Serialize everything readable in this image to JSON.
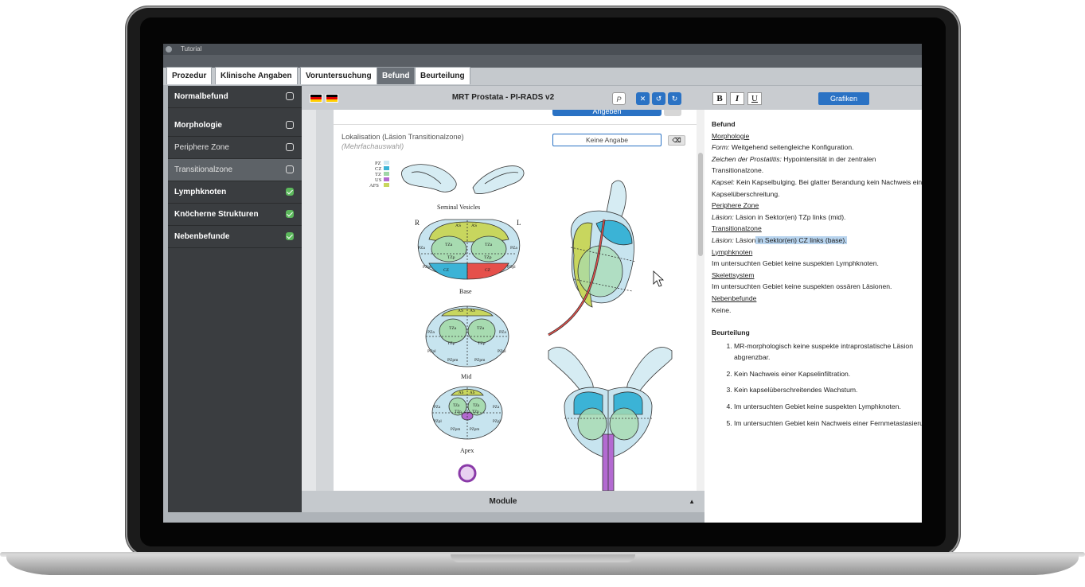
{
  "app": {
    "title": "Tutorial"
  },
  "tabs": [
    {
      "label": "Prozedur",
      "active": false
    },
    {
      "label": "Klinische Angaben",
      "active": false
    },
    {
      "label": "Voruntersuchung",
      "active": false
    },
    {
      "label": "Befund",
      "active": true
    },
    {
      "label": "Beurteilung",
      "active": false
    }
  ],
  "sidebar": {
    "items": [
      {
        "label": "Normalbefund",
        "checked": false
      },
      {
        "label": "Morphologie",
        "checked": false
      },
      {
        "label": "Periphere Zone",
        "checked": false
      },
      {
        "label": "Transitionalzone",
        "checked": false
      },
      {
        "label": "Lymphknoten",
        "checked": true
      },
      {
        "label": "Knöcherne Strukturen",
        "checked": true
      },
      {
        "label": "Nebenbefunde",
        "checked": true
      }
    ]
  },
  "middle": {
    "title": "MRT Prostata - PI-RADS v2",
    "top_button": "Angeben",
    "field_label": "Lokalisation (Läsion Transitionalzone)",
    "field_hint": "(Mehrfachauswahl)",
    "field_value": "Keine Angabe",
    "footer": "Module",
    "diagram": {
      "legend": [
        "PZ",
        "CZ",
        "TZ",
        "US",
        "AFS"
      ],
      "legend_colors": [
        "#cde8f2",
        "#3bb3d6",
        "#9fd6a6",
        "#b36ad1",
        "#c8d65e"
      ],
      "sv_label": "Seminal Vesicles",
      "side_r": "R",
      "side_l": "L",
      "base_label": "Base",
      "mid_label": "Mid",
      "apex_label": "Apex",
      "base_zones": [
        "AS",
        "AS",
        "TZa",
        "TZa",
        "PZa",
        "PZa",
        "TZp",
        "TZp",
        "PZpl",
        "PZpl",
        "CZ",
        "CZ"
      ],
      "mid_zones": [
        "AS",
        "AS",
        "TZa",
        "TZa",
        "PZa",
        "PZa",
        "TZp",
        "TZp",
        "PZpl",
        "PZpl",
        "PZpm",
        "PZpm"
      ],
      "apex_zones": [
        "AS",
        "AS",
        "TZa",
        "TZa",
        "PZa",
        "PZa",
        "TZp",
        "TZp",
        "PZpl",
        "PZpl",
        "PZpm",
        "PZpm"
      ]
    }
  },
  "report": {
    "toolbar": {
      "bold": "B",
      "italic": "I",
      "underline": "U",
      "grafiken": "Grafiken"
    },
    "befund_title": "Befund",
    "morph_head": "Morphologie",
    "form_label": "Form:",
    "form_text": " Weitgehend seitengleiche Konfiguration.",
    "prost_label": "Zeichen der Prostatitis:",
    "prost_text": " Hypointensität in der zentralen Transitionalzone.",
    "kapsel_label": "Kapsel:",
    "kapsel_text": " Kein Kapselbulging. Bei glatter Berandung kein Nachweis einer Kapselüberschreitung.",
    "pz_head": "Periphere Zone",
    "pz_label": "Läsion:",
    "pz_text": " Läsion in Sektor(en) TZp links (mid).",
    "tz_head": "Transitionalzone",
    "tz_label": "Läsion:",
    "tz_text_a": " Läsion",
    "tz_text_b": " in Sektor(en) CZ links (base).",
    "lk_head": "Lymphknoten",
    "lk_text": "Im untersuchten Gebiet keine suspekten Lymphknoten.",
    "sk_head": "Skelettsystem",
    "sk_text": "Im untersuchten Gebiet keine suspekten ossären Läsionen.",
    "nb_head": "Nebenbefunde",
    "nb_text": "Keine.",
    "beurteilung_title": "Beurteilung",
    "beurteilung_items": [
      "MR-morphologisch keine suspekte intraprostatische Läsion abgrenzbar.",
      "Kein Nachweis einer Kapselinfiltration.",
      "Kein kapselüberschreitendes Wachstum.",
      "Im untersuchten Gebiet keine suspekten Lymphknoten.",
      "Im untersuchten Gebiet kein Nachweis einer Fernmetastasierung."
    ]
  }
}
